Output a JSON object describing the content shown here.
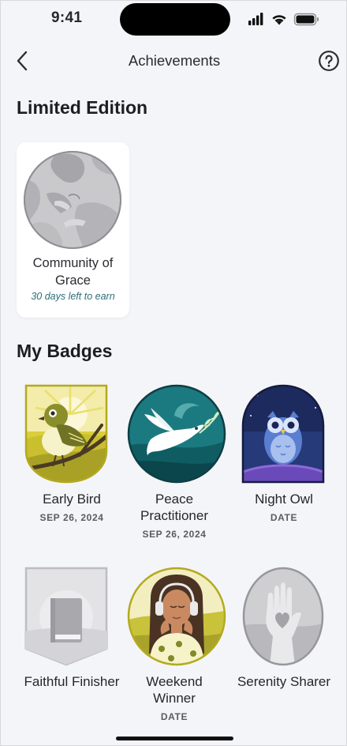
{
  "status_bar": {
    "time": "9:41"
  },
  "nav": {
    "title": "Achievements"
  },
  "limited_edition": {
    "heading": "Limited Edition",
    "card": {
      "name": "Community of Grace",
      "note": "30 days left to earn"
    }
  },
  "my_badges": {
    "heading": "My Badges",
    "items": [
      {
        "name": "Early Bird",
        "date": "SEP 26, 2024"
      },
      {
        "name": "Peace Practitioner",
        "date": "SEP 26, 2024"
      },
      {
        "name": "Night Owl",
        "date": "DATE"
      },
      {
        "name": "Faithful Finisher",
        "date": ""
      },
      {
        "name": "Weekend Winner",
        "date": "DATE"
      },
      {
        "name": "Serenity Sharer",
        "date": ""
      }
    ]
  },
  "colors": {
    "background": "#f4f5f8",
    "accent_teal": "#2c6e78",
    "locked_gray": "#b9b9bd"
  },
  "icons": [
    "back-chevron-icon",
    "help-circle-icon",
    "signal-icon",
    "wifi-icon",
    "battery-icon"
  ]
}
